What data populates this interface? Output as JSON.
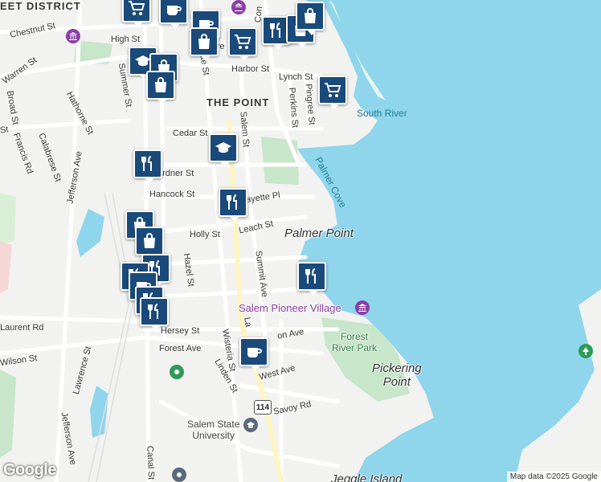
{
  "neighborhood": "THE POINT",
  "district_fragment": "EET DISTRICT",
  "streets": {
    "chestnut": "Chestnut St",
    "high": "High St",
    "warren": "Warren St",
    "summer": "Summer St",
    "broad": "Broad St",
    "hathorne": "Hathorne St",
    "francis": "Francis Rd",
    "calabrese": "Calabrese St",
    "jefferson_1": "Jefferson Ave",
    "jefferson_2": "Jefferson Ave",
    "harbor": "Harbor St",
    "lynch": "Lynch St",
    "pingree": "Pingree St",
    "perkins": "Perkins St",
    "salem": "Salem St",
    "cedar": "Cedar St",
    "gardner": "ardner St",
    "hancock": "Hancock St",
    "fayette": "ayette Pl",
    "leach": "Leach St",
    "holly": "Holly St",
    "hazel": "Hazel St",
    "summit": "Summit Ave",
    "laurent": "Laurent Rd",
    "hersey": "Hersey St",
    "forest": "Forest Ave",
    "wilson": "Wilson St",
    "lawrence": "Lawrence St",
    "wisteria": "Wisteria St",
    "linden": "Linden St",
    "west": "West Ave",
    "savoy": "Savoy Rd",
    "canal": "Canal St",
    "lafayette": "La",
    "congress": "Con",
    "st_fragment": "St",
    "lafayette_upper": "ette St",
    "ston_ave": "on Ave",
    "pe": "Pe"
  },
  "water": {
    "south_river": "South River",
    "palmer_cove": "Palmer Cove"
  },
  "places": {
    "palmer_point": "Palmer Point",
    "pickering_point": "Pickering\nPoint",
    "jeggle_island": "Jeggle Island"
  },
  "pois": {
    "salem_pioneer_village": "Salem Pioneer Village",
    "forest_river_park": "Forest\nRiver Park",
    "salem_state": "Salem State\nUniversity"
  },
  "route_shield": "114",
  "credit": "Map data ©2025 Google",
  "logo": "Google",
  "markers": [
    {
      "type": "cart-icon"
    },
    {
      "type": "cup-icon"
    },
    {
      "type": "cup-icon"
    },
    {
      "type": "bag-icon"
    },
    {
      "type": "cart-icon"
    },
    {
      "type": "fork-knife-icon"
    },
    {
      "type": "bag-icon"
    },
    {
      "type": "bag-icon"
    },
    {
      "type": "school-icon"
    },
    {
      "type": "bag-icon"
    },
    {
      "type": "bag-icon"
    },
    {
      "type": "cart-icon"
    },
    {
      "type": "school-icon"
    },
    {
      "type": "fork-knife-icon"
    },
    {
      "type": "fork-knife-icon"
    },
    {
      "type": "bag-icon"
    },
    {
      "type": "bag-icon"
    },
    {
      "type": "fork-knife-icon"
    },
    {
      "type": "fork-knife-icon"
    },
    {
      "type": "cup-icon"
    },
    {
      "type": "fork-knife-icon"
    },
    {
      "type": "fork-knife-icon"
    },
    {
      "type": "fork-knife-icon"
    },
    {
      "type": "cup-icon"
    }
  ],
  "colors": {
    "water": "#8fd5ec",
    "land": "#f2f2f0",
    "park": "#c8e6c9",
    "marker": "#1a4a7a",
    "road": "#ffffff"
  }
}
